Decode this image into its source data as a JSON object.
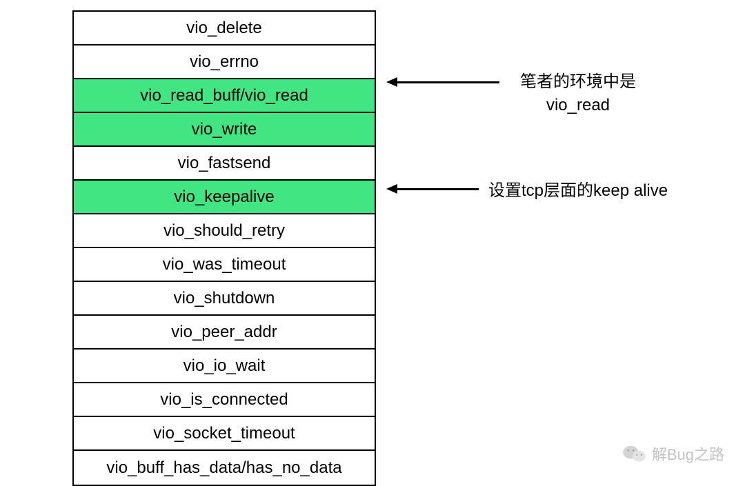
{
  "rows": [
    {
      "label": "vio_delete",
      "highlighted": false
    },
    {
      "label": "vio_errno",
      "highlighted": false
    },
    {
      "label": "vio_read_buff/vio_read",
      "highlighted": true
    },
    {
      "label": "vio_write",
      "highlighted": true
    },
    {
      "label": "vio_fastsend",
      "highlighted": false
    },
    {
      "label": "vio_keepalive",
      "highlighted": true
    },
    {
      "label": "vio_should_retry",
      "highlighted": false
    },
    {
      "label": "vio_was_timeout",
      "highlighted": false
    },
    {
      "label": "vio_shutdown",
      "highlighted": false
    },
    {
      "label": "vio_peer_addr",
      "highlighted": false
    },
    {
      "label": "vio_io_wait",
      "highlighted": false
    },
    {
      "label": "vio_is_connected",
      "highlighted": false
    },
    {
      "label": "vio_socket_timeout",
      "highlighted": false
    },
    {
      "label": "vio_buff_has_data/has_no_data",
      "highlighted": false
    }
  ],
  "annotations": {
    "read": {
      "line1": "笔者的环境中是",
      "line2": "vio_read"
    },
    "keepalive": "设置tcp层面的keep alive"
  },
  "watermark": "解Bug之路"
}
